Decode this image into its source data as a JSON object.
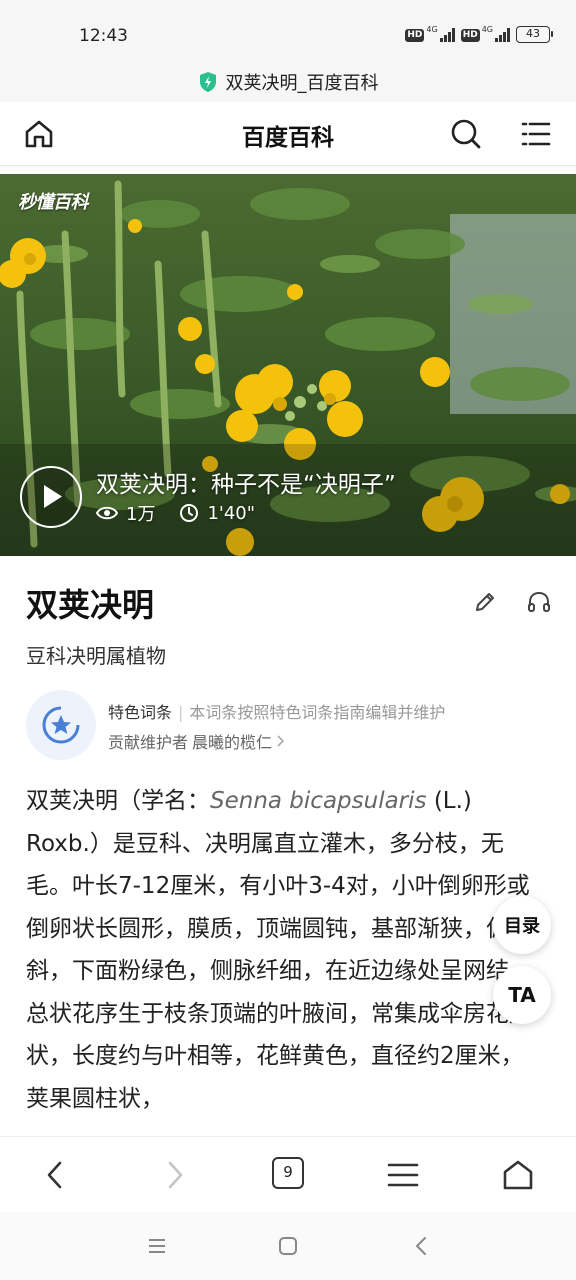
{
  "status_bar": {
    "time": "12:43",
    "hd_label": "HD",
    "network_label": "4G",
    "battery": "43",
    "icons": [
      "hd-icon",
      "signal-icon",
      "battery-icon"
    ]
  },
  "browser": {
    "url_title": "双荚决明_百度百科",
    "url_icon": "shield-icon",
    "tab_count": "9",
    "toolbar_icons": [
      "back-icon",
      "forward-icon",
      "tabs-icon",
      "menu-icon",
      "home-icon"
    ]
  },
  "header": {
    "title": "百度百科",
    "icons": [
      "home-icon",
      "search-icon",
      "menu-icon"
    ]
  },
  "video": {
    "brand": "秒懂百科",
    "title": "双荚决明：种子不是“决明子”",
    "views": "1万",
    "duration": "1'40\""
  },
  "entry": {
    "title": "双荚决明",
    "subtitle": "豆科决明属植物",
    "featured_label": "特色词条",
    "featured_desc": "本词条按照特色词条指南编辑并维护",
    "maintainer_label": "贡献维护者",
    "maintainer_name": "晨曦的榄仁",
    "body_before": "双荚决明（学名：",
    "body_latin": "Senna bicapsularis",
    "body_after": " (L.) Roxb.）是豆科、决明属直立灌木，多分枝，无毛。叶长7-12厘米，有小叶3-4对，小叶倒卵形或倒卵状长圆形，膜质，顶端圆钝，基部渐狭，偏斜，下面粉绿色，侧脉纤细，在近边缘处呈网结，总状花序生于枝条顶端的叶腋间，常集成伞房花序状，长度约与叶相等，花鲜黄色，直径约2厘米，荚果圆柱状，"
  },
  "floating": {
    "toc_label": "目录",
    "ta_label": "TA"
  },
  "colors": {
    "accent_green": "#2bbf8f",
    "badge_blue": "#4a7fd6",
    "flower_yellow": "#f4c20d",
    "foliage_green": "#3f6b2a"
  }
}
